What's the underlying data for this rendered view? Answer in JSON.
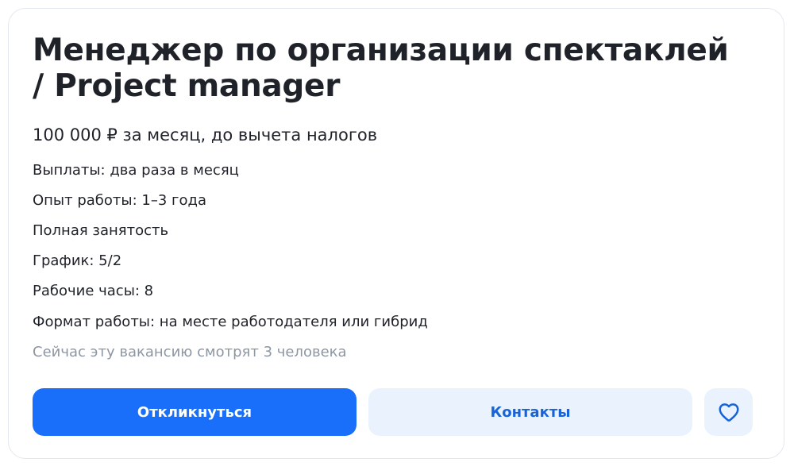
{
  "vacancy": {
    "title": "Менеджер по организации спектаклей / Project manager",
    "salary": "100 000 ₽ за месяц, до вычета налогов",
    "details": [
      "Выплаты: два раза в месяц",
      "Опыт работы: 1–3 года",
      "Полная занятость",
      "График: 5/2",
      "Рабочие часы: 8",
      "Формат работы: на месте работодателя или гибрид"
    ],
    "viewers": "Сейчас эту вакансию смотрят 3 человека"
  },
  "actions": {
    "respond_label": "Откликнуться",
    "contacts_label": "Контакты",
    "favorite_icon": "heart-icon"
  },
  "colors": {
    "primary": "#1a6ffa",
    "secondary_bg": "#eaf3fd",
    "secondary_text": "#1764d8",
    "muted_text": "#8d96a3"
  }
}
